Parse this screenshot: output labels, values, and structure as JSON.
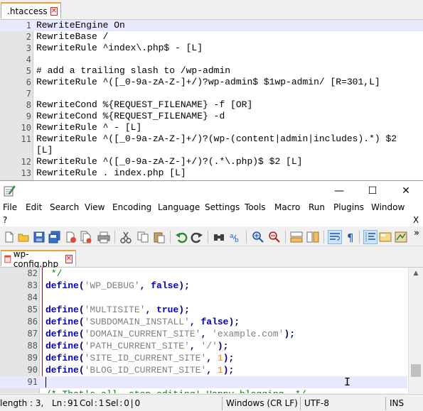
{
  "top_window": {
    "tab": {
      "label": ".htaccess"
    },
    "lines": [
      {
        "num": "1",
        "text": "RewriteEngine On"
      },
      {
        "num": "2",
        "text": "RewriteBase /"
      },
      {
        "num": "3",
        "text": "RewriteRule ^index\\.php$ - [L]"
      },
      {
        "num": "4",
        "text": ""
      },
      {
        "num": "5",
        "text": "# add a trailing slash to /wp-admin"
      },
      {
        "num": "6",
        "text": "RewriteRule ^([_0-9a-zA-Z-]+/)?wp-admin$ $1wp-admin/ [R=301,L]"
      },
      {
        "num": "7",
        "text": ""
      },
      {
        "num": "8",
        "text": "RewriteCond %{REQUEST_FILENAME} -f [OR]"
      },
      {
        "num": "9",
        "text": "RewriteCond %{REQUEST_FILENAME} -d"
      },
      {
        "num": "10",
        "text": "RewriteRule ^ - [L]"
      },
      {
        "num": "11",
        "text": "RewriteRule ^([_0-9a-zA-Z-]+/)?(wp-(content|admin|includes).*) $2"
      },
      {
        "num": "",
        "text": "[L]"
      },
      {
        "num": "12",
        "text": "RewriteRule ^([_0-9a-zA-Z-]+/)?(.*\\.php)$ $2 [L]"
      },
      {
        "num": "13",
        "text": "RewriteRule . index.php [L]"
      }
    ]
  },
  "bottom_window": {
    "window_controls": {
      "minimize": "—",
      "maximize": "☐",
      "close": "✕"
    },
    "menu": [
      "File",
      "Edit",
      "Search",
      "View",
      "Encoding",
      "Language",
      "Settings",
      "Tools",
      "Macro",
      "Run",
      "Plugins",
      "Window"
    ],
    "menu2": {
      "help": "?",
      "close_doc": "X"
    },
    "toolbar": {
      "icons": [
        "new-file-icon",
        "open-file-icon",
        "save-icon",
        "save-all-icon",
        "close-icon",
        "close-all-icon",
        "print-icon",
        "cut-icon",
        "copy-icon",
        "paste-icon",
        "undo-icon",
        "redo-icon",
        "find-icon",
        "replace-icon",
        "zoom-in-icon",
        "zoom-out-icon",
        "sync-vertical-icon",
        "sync-horizontal-icon",
        "word-wrap-icon",
        "show-all-chars-icon",
        "indent-guide-icon",
        "user-defined-language-icon",
        "document-map-icon"
      ],
      "overflow": "»"
    },
    "tab": {
      "label": "wp-config.php"
    },
    "lines": [
      {
        "num": "82",
        "parts": [
          {
            "t": " */",
            "c": "cmt"
          }
        ]
      },
      {
        "num": "83",
        "parts": [
          {
            "t": "define",
            "c": "kw"
          },
          {
            "t": "(",
            "c": "pun"
          },
          {
            "t": "'WP_DEBUG'",
            "c": "str"
          },
          {
            "t": ", ",
            "c": "pun"
          },
          {
            "t": "false",
            "c": "kw"
          },
          {
            "t": ");",
            "c": "pun"
          }
        ]
      },
      {
        "num": "84",
        "parts": []
      },
      {
        "num": "85",
        "parts": [
          {
            "t": "define",
            "c": "kw"
          },
          {
            "t": "(",
            "c": "pun"
          },
          {
            "t": "'MULTISITE'",
            "c": "str"
          },
          {
            "t": ", ",
            "c": "pun"
          },
          {
            "t": "true",
            "c": "kw"
          },
          {
            "t": ");",
            "c": "pun"
          }
        ]
      },
      {
        "num": "86",
        "parts": [
          {
            "t": "define",
            "c": "kw"
          },
          {
            "t": "(",
            "c": "pun"
          },
          {
            "t": "'SUBDOMAIN_INSTALL'",
            "c": "str"
          },
          {
            "t": ", ",
            "c": "pun"
          },
          {
            "t": "false",
            "c": "kw"
          },
          {
            "t": ");",
            "c": "pun"
          }
        ]
      },
      {
        "num": "87",
        "parts": [
          {
            "t": "define",
            "c": "kw"
          },
          {
            "t": "(",
            "c": "pun"
          },
          {
            "t": "'DOMAIN_CURRENT_SITE'",
            "c": "str"
          },
          {
            "t": ", ",
            "c": "pun"
          },
          {
            "t": "'example.com'",
            "c": "str"
          },
          {
            "t": ");",
            "c": "pun"
          }
        ]
      },
      {
        "num": "88",
        "parts": [
          {
            "t": "define",
            "c": "kw"
          },
          {
            "t": "(",
            "c": "pun"
          },
          {
            "t": "'PATH_CURRENT_SITE'",
            "c": "str"
          },
          {
            "t": ", ",
            "c": "pun"
          },
          {
            "t": "'/'",
            "c": "str"
          },
          {
            "t": ");",
            "c": "pun"
          }
        ]
      },
      {
        "num": "89",
        "parts": [
          {
            "t": "define",
            "c": "kw"
          },
          {
            "t": "(",
            "c": "pun"
          },
          {
            "t": "'SITE_ID_CURRENT_SITE'",
            "c": "str"
          },
          {
            "t": ", ",
            "c": "pun"
          },
          {
            "t": "1",
            "c": "num"
          },
          {
            "t": ");",
            "c": "pun"
          }
        ]
      },
      {
        "num": "90",
        "parts": [
          {
            "t": "define",
            "c": "kw"
          },
          {
            "t": "(",
            "c": "pun"
          },
          {
            "t": "'BLOG_ID_CURRENT_SITE'",
            "c": "str"
          },
          {
            "t": ", ",
            "c": "pun"
          },
          {
            "t": "1",
            "c": "num"
          },
          {
            "t": ");",
            "c": "pun"
          }
        ]
      },
      {
        "num": "91",
        "parts": [],
        "current": true
      },
      {
        "num": "",
        "parts": [
          {
            "t": "/* That's all, stop editing! Happy blogging. */",
            "c": "cmt"
          }
        ]
      }
    ],
    "scrollbar": {
      "up_arrow": "▲"
    },
    "status": {
      "length": "length : 3,",
      "position": "Ln : 91    Col : 1    Sel : 0 | 0",
      "eol": "Windows (CR LF)",
      "encoding": "UTF-8",
      "mode": "INS"
    }
  },
  "colors": {
    "keyword": "#0000c0",
    "string": "#808080",
    "number": "#ff8000",
    "comment": "#008000",
    "current_line": "#e8e8ff",
    "tab_accent": "#f0a030"
  }
}
